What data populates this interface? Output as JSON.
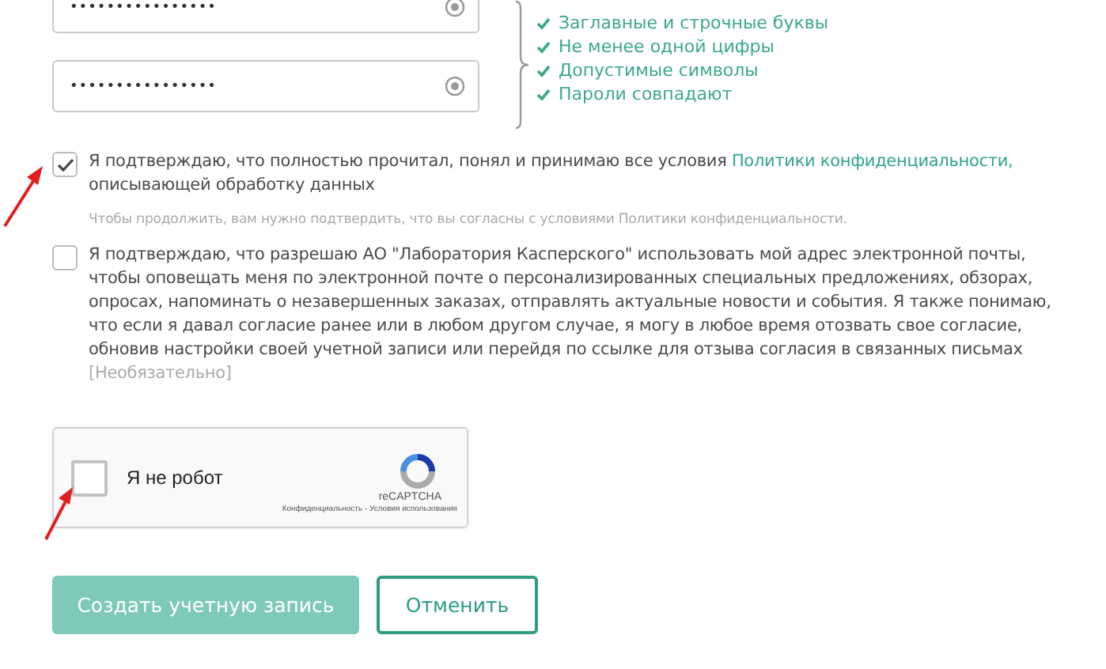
{
  "password_fields": [
    {
      "value": "••••••••••••••••"
    },
    {
      "value": "••••••••••••••••"
    }
  ],
  "requirements": [
    {
      "label": "Заглавные и строчные буквы",
      "met": true
    },
    {
      "label": "Не менее одной цифры",
      "met": true
    },
    {
      "label": "Допустимые символы",
      "met": true
    },
    {
      "label": "Пароли совпадают",
      "met": true
    }
  ],
  "consents": [
    {
      "checked": true,
      "text": "Я подтверждаю, что полностью прочитал, понял и принимаю все условия ",
      "link": "Политики конфиденциальности,",
      "text_after": " описывающей обработку данных",
      "hint": "Чтобы продолжить, вам нужно подтвердить, что вы согласны с условиями Политики конфиденциальности."
    },
    {
      "checked": false,
      "text": "Я подтверждаю, что разрешаю АО \"Лаборатория Касперского\" использовать мой адрес электронной почты, чтобы оповещать меня по электронной почте о персонализированных специальных предложениях, обзорах, опросах, напоминать о незавершенных заказах, отправлять актуальные новости и события. Я также понимаю, что если я давал согласие ранее или в любом другом случае, я могу в любое время отозвать свое согласие, обновив настройки своей учетной записи или перейдя по ссылке для отзыва согласия в связанных письмах",
      "optional": "[Необязательно]"
    }
  ],
  "captcha": {
    "checked": false,
    "label": "Я не робот",
    "brand": "reCAPTCHA",
    "terms": "Конфиденциальность - Условия использования"
  },
  "buttons": [
    {
      "label": "Создать учетную запись",
      "kind": "primary"
    },
    {
      "label": "Отменить",
      "kind": "secondary"
    }
  ]
}
